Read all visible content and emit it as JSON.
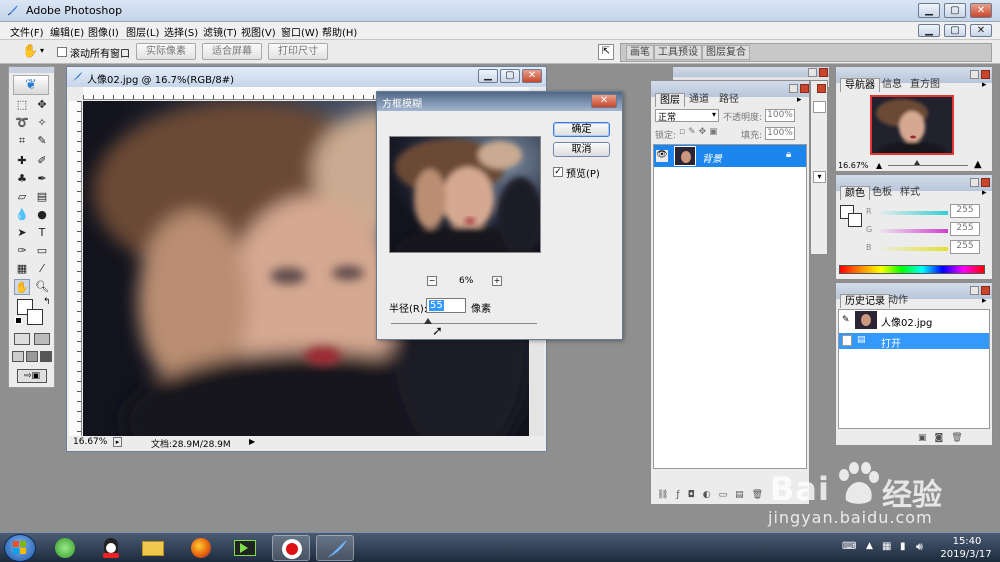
{
  "window": {
    "title": "Adobe Photoshop"
  },
  "menu": [
    {
      "label": "文件(F)"
    },
    {
      "label": "编辑(E)"
    },
    {
      "label": "图像(I)"
    },
    {
      "label": "图层(L)"
    },
    {
      "label": "选择(S)"
    },
    {
      "label": "滤镜(T)"
    },
    {
      "label": "视图(V)"
    },
    {
      "label": "窗口(W)"
    },
    {
      "label": "帮助(H)"
    }
  ],
  "options_bar": {
    "scroll_all_label": "滚动所有窗口",
    "actual_pixels": "实际像素",
    "fit_screen": "适合屏幕",
    "print_size": "打印尺寸",
    "palette_well_tabs": [
      "画笔",
      "工具预设",
      "图层复合"
    ]
  },
  "document": {
    "title": "人像02.jpg @ 16.7%(RGB/8#)",
    "zoom": "16.67%",
    "doc_info": "文档:28.9M/28.9M"
  },
  "dialog": {
    "title": "方框模糊",
    "ok": "确定",
    "cancel": "取消",
    "preview_label": "预览(P)",
    "preview_checked": true,
    "zoom": "6%",
    "zoom_minus": "−",
    "zoom_plus": "+",
    "radius_label": "半径(R):",
    "radius_value": "55",
    "radius_unit": "像素",
    "radius_fraction": 0.25
  },
  "layers_panel": {
    "tabs": [
      "图层",
      "通道",
      "路径"
    ],
    "blend_mode": "正常",
    "opacity_label": "不透明度:",
    "opacity_value": "100%",
    "lock_label": "锁定:",
    "fill_label": "填充:",
    "fill_value": "100%",
    "layer_name": "背景"
  },
  "navigator_panel": {
    "tabs": [
      "导航器",
      "信息",
      "直方图"
    ],
    "zoom": "16.67%"
  },
  "color_panel": {
    "tabs": [
      "颜色",
      "色板",
      "样式"
    ],
    "channels": [
      {
        "label": "R",
        "value": "255",
        "color": "#35d0d0"
      },
      {
        "label": "G",
        "value": "255",
        "color": "#d040d0"
      },
      {
        "label": "B",
        "value": "255",
        "color": "#e0e030"
      }
    ]
  },
  "history_panel": {
    "tabs": [
      "历史记录",
      "动作"
    ],
    "snapshot": "人像02.jpg",
    "steps": [
      "打开"
    ]
  },
  "taskbar": {
    "time": "15:40",
    "date": "2019/3/17"
  },
  "watermark": {
    "brand_left": "Bai",
    "brand_right": "经验",
    "url": "jingyan.baidu.com"
  },
  "colors": {
    "accent": "#3399ff",
    "selection": "#1c86ee",
    "taskbar": "#24324a"
  }
}
